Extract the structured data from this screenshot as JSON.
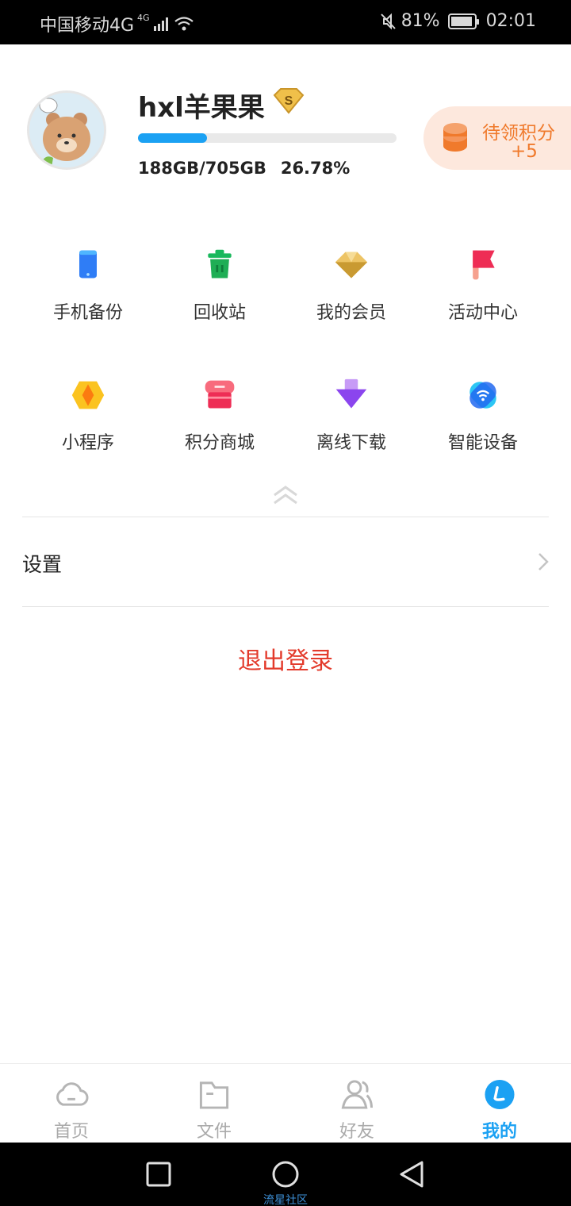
{
  "status_bar": {
    "carrier": "中国移动4G",
    "network_sup": "4G",
    "battery_pct": "81%",
    "time": "02:01"
  },
  "profile": {
    "username": "hxl羊果果",
    "vip_badge": "S",
    "storage_used": "188GB/705GB",
    "storage_percent": "26.78%",
    "storage_fraction": 0.2678
  },
  "points": {
    "title": "待领积分",
    "count": "+5"
  },
  "grid": [
    {
      "label": "手机备份",
      "icon": "phone-backup-icon"
    },
    {
      "label": "回收站",
      "icon": "trash-icon"
    },
    {
      "label": "我的会员",
      "icon": "diamond-icon"
    },
    {
      "label": "活动中心",
      "icon": "flag-icon"
    },
    {
      "label": "小程序",
      "icon": "mini-program-icon"
    },
    {
      "label": "积分商城",
      "icon": "store-icon"
    },
    {
      "label": "离线下载",
      "icon": "download-icon"
    },
    {
      "label": "智能设备",
      "icon": "smart-device-icon"
    }
  ],
  "settings": {
    "label": "设置"
  },
  "logout": {
    "label": "退出登录"
  },
  "tabs": [
    {
      "label": "首页",
      "icon": "cloud-icon"
    },
    {
      "label": "文件",
      "icon": "folder-icon"
    },
    {
      "label": "好友",
      "icon": "friends-icon"
    },
    {
      "label": "我的",
      "icon": "me-icon"
    }
  ],
  "watermark": "流星社区",
  "colors": {
    "accent": "#1ba1f3",
    "logout": "#e33a2b",
    "points": "#f07a2c"
  }
}
